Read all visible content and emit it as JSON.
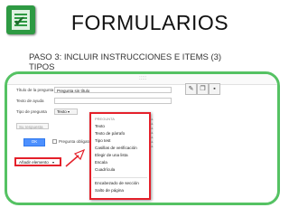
{
  "slide": {
    "title": "FORMULARIOS",
    "subtitle": "PASO 3: INCLUIR INSTRUCCIONES E ITEMS (3) TIPOS"
  },
  "form": {
    "question_title_label": "Título de la pregunta",
    "question_title_value": "Pregunta sin título",
    "help_text_label": "Texto de ayuda",
    "question_type_label": "Tipo de pregunta",
    "question_type_value": "Texto",
    "answer_placeholder": "Su respuesta",
    "done_button": "OK",
    "required_label": "Pregunta obligatoria",
    "add_item_button": "Añadir elemento"
  },
  "menu": {
    "header": "PREGUNTA",
    "items": [
      "Texto",
      "Texto de párrafo",
      "Tipo test",
      "Casillas de verificación",
      "Elegir de una lista",
      "Escala",
      "Cuadrícula"
    ],
    "layout_items": [
      "Encabezado de sección",
      "Salto de página"
    ]
  },
  "colors": {
    "frame_border": "#55c263",
    "highlight_red": "#e4202a",
    "button_blue": "#4d90fe"
  },
  "icons": {
    "logo": "forms-logo-icon",
    "edit": "pencil-icon",
    "duplicate": "duplicate-icon",
    "delete": "trash-icon",
    "arrow": "pointer-arrow-icon"
  }
}
